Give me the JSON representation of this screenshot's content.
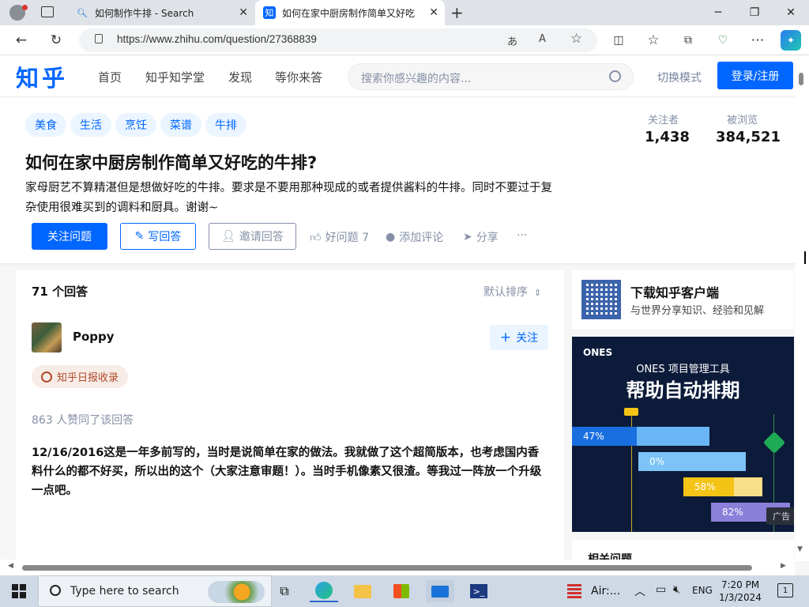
{
  "browser": {
    "tabs": [
      {
        "title": "如何制作牛排 - Search",
        "favicon": "search-icon"
      },
      {
        "title": "如何在家中厨房制作简单又好吃",
        "favicon": "知"
      }
    ],
    "url": "https://www.zhihu.com/question/27368839"
  },
  "header": {
    "logo": "知乎",
    "nav": [
      "首页",
      "知乎知学堂",
      "发现",
      "等你来答"
    ],
    "search_placeholder": "搜索你感兴趣的内容...",
    "switch_mode": "切换模式",
    "login": "登录/注册"
  },
  "question": {
    "topics": [
      "美食",
      "生活",
      "烹饪",
      "菜谱",
      "牛排"
    ],
    "followers_label": "关注者",
    "followers": "1,438",
    "views_label": "被浏览",
    "views": "384,521",
    "title": "如何在家中厨房制作简单又好吃的牛排?",
    "description": "家母厨艺不算精湛但是想做好吃的牛排。要求是不要用那种现成的或者提供酱料的牛排。同时不要过于复杂使用很难买到的调料和厨具。谢谢~",
    "follow_btn": "关注问题",
    "write_btn": "写回答",
    "invite_btn": "邀请回答",
    "good_question": "好问题 7",
    "comment": "添加评论",
    "share": "分享",
    "more": "···"
  },
  "answers": {
    "count": "71 个回答",
    "sort": "默认排序",
    "author": "Poppy",
    "follow_author": "关注",
    "badge": "知乎日报收录",
    "votes": "863 人赞同了该回答",
    "body": "12/16/2016这是一年多前写的，当时是说简单在家的做法。我就做了这个超简版本，也考虑国内香料什么的都不好买，所以出的这个（大家注意审题！）。当时手机像素又很渣。等我过一阵放一个升级一点吧。"
  },
  "sidebar": {
    "app_title": "下载知乎客户端",
    "app_sub": "与世界分享知识、经验和见解",
    "ad": {
      "logo": "ONES",
      "line1": "ONES 项目管理工具",
      "line2": "帮助自动排期",
      "bars": [
        "47%",
        "0%",
        "58%",
        "82%"
      ],
      "tag": "广告"
    },
    "related_title": "相关问题"
  },
  "taskbar": {
    "search": "Type here to search",
    "air": "Air:...",
    "lang": "ENG",
    "time": "7:20 PM",
    "date": "1/3/2024",
    "notif_count": "1"
  }
}
